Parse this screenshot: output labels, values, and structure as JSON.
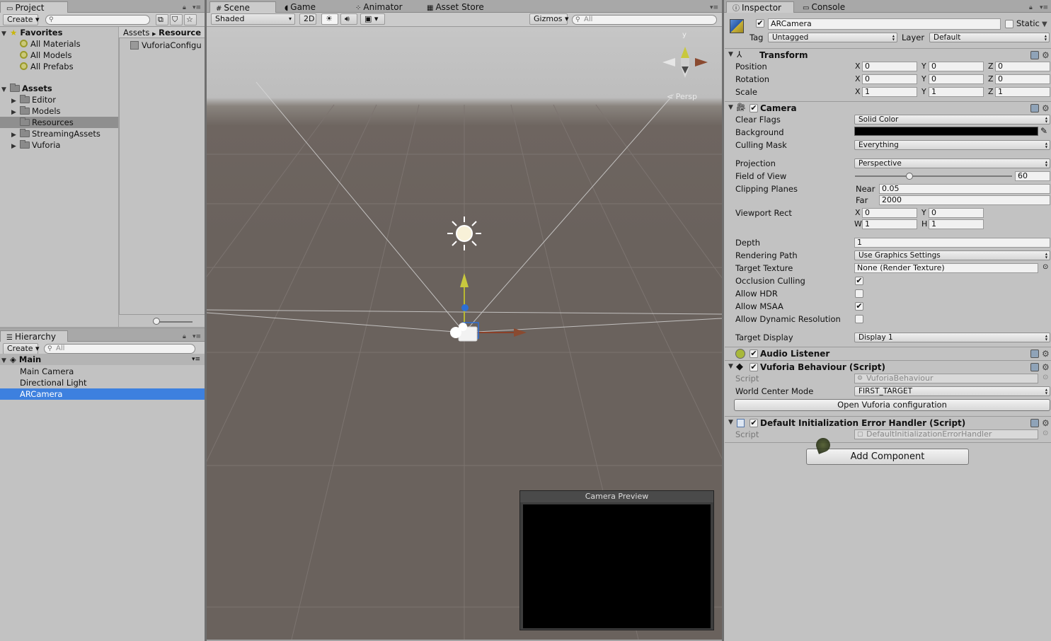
{
  "project": {
    "tab_label": "Project",
    "create_label": "Create",
    "search_placeholder": "",
    "favorites_label": "Favorites",
    "favorites": [
      "All Materials",
      "All Models",
      "All Prefabs"
    ],
    "assets_label": "Assets",
    "asset_folders": [
      "Editor",
      "Models",
      "Resources",
      "StreamingAssets",
      "Vuforia"
    ],
    "selected_folder": "Resources",
    "breadcrumb": [
      "Assets",
      "Resource"
    ],
    "files": [
      "VuforiaConfigu"
    ]
  },
  "hierarchy": {
    "tab_label": "Hierarchy",
    "create_label": "Create",
    "search_placeholder": "All",
    "scene_name": "Main",
    "items": [
      "Main Camera",
      "Directional Light",
      "ARCamera"
    ],
    "selected": "ARCamera"
  },
  "scene": {
    "tabs": [
      "Scene",
      "Game",
      "Animator",
      "Asset Store"
    ],
    "active_tab": "Scene",
    "shading_mode": "Shaded",
    "mode_2d": "2D",
    "gizmos_label": "Gizmos",
    "search_placeholder": "All",
    "gizmo_axis_y": "y",
    "persp_label": "Persp",
    "camera_preview_title": "Camera Preview"
  },
  "inspector": {
    "tabs": [
      "Inspector",
      "Console"
    ],
    "object_name": "ARCamera",
    "static_label": "Static",
    "tag_label": "Tag",
    "tag_value": "Untagged",
    "layer_label": "Layer",
    "layer_value": "Default",
    "transform": {
      "title": "Transform",
      "position_label": "Position",
      "rotation_label": "Rotation",
      "scale_label": "Scale",
      "position": [
        "0",
        "0",
        "0"
      ],
      "rotation": [
        "0",
        "0",
        "0"
      ],
      "scale": [
        "1",
        "1",
        "1"
      ]
    },
    "axes": {
      "x": "X",
      "y": "Y",
      "z": "Z",
      "w": "W",
      "h": "H"
    },
    "camera": {
      "title": "Camera",
      "clear_flags_label": "Clear Flags",
      "clear_flags": "Solid Color",
      "background_label": "Background",
      "background_color": "#000000",
      "culling_mask_label": "Culling Mask",
      "culling_mask": "Everything",
      "projection_label": "Projection",
      "projection": "Perspective",
      "fov_label": "Field of View",
      "fov": "60",
      "fov_slider_fraction": 0.34,
      "clipping_label": "Clipping Planes",
      "near_label": "Near",
      "near": "0.05",
      "far_label": "Far",
      "far": "2000",
      "viewport_label": "Viewport Rect",
      "viewport_x": "0",
      "viewport_y": "0",
      "viewport_w": "1",
      "viewport_h": "1",
      "depth_label": "Depth",
      "depth": "1",
      "rendering_path_label": "Rendering Path",
      "rendering_path": "Use Graphics Settings",
      "target_texture_label": "Target Texture",
      "target_texture": "None (Render Texture)",
      "occlusion_label": "Occlusion Culling",
      "occlusion": true,
      "hdr_label": "Allow HDR",
      "hdr": false,
      "msaa_label": "Allow MSAA",
      "msaa": true,
      "dynres_label": "Allow Dynamic Resolution",
      "dynres": false,
      "target_display_label": "Target Display",
      "target_display": "Display 1"
    },
    "audio_listener_title": "Audio Listener",
    "vuforia": {
      "title": "Vuforia Behaviour (Script)",
      "script_label": "Script",
      "script": "VuforiaBehaviour",
      "world_center_label": "World Center Mode",
      "world_center": "FIRST_TARGET",
      "open_config_label": "Open Vuforia configuration"
    },
    "error_handler": {
      "title": "Default Initialization Error Handler (Script)",
      "script_label": "Script",
      "script": "DefaultInitializationErrorHandler"
    },
    "add_component_label": "Add Component"
  },
  "colors": {
    "selection": "#3d80df",
    "panel": "#c2c2c2",
    "scene_ground": "#6a625d"
  },
  "icons": [
    "search-icon",
    "star-icon",
    "folder-icon",
    "menu-icon",
    "lock-icon",
    "gear-icon",
    "help-book-icon",
    "camera-icon",
    "sun-icon",
    "eyedropper-icon"
  ]
}
